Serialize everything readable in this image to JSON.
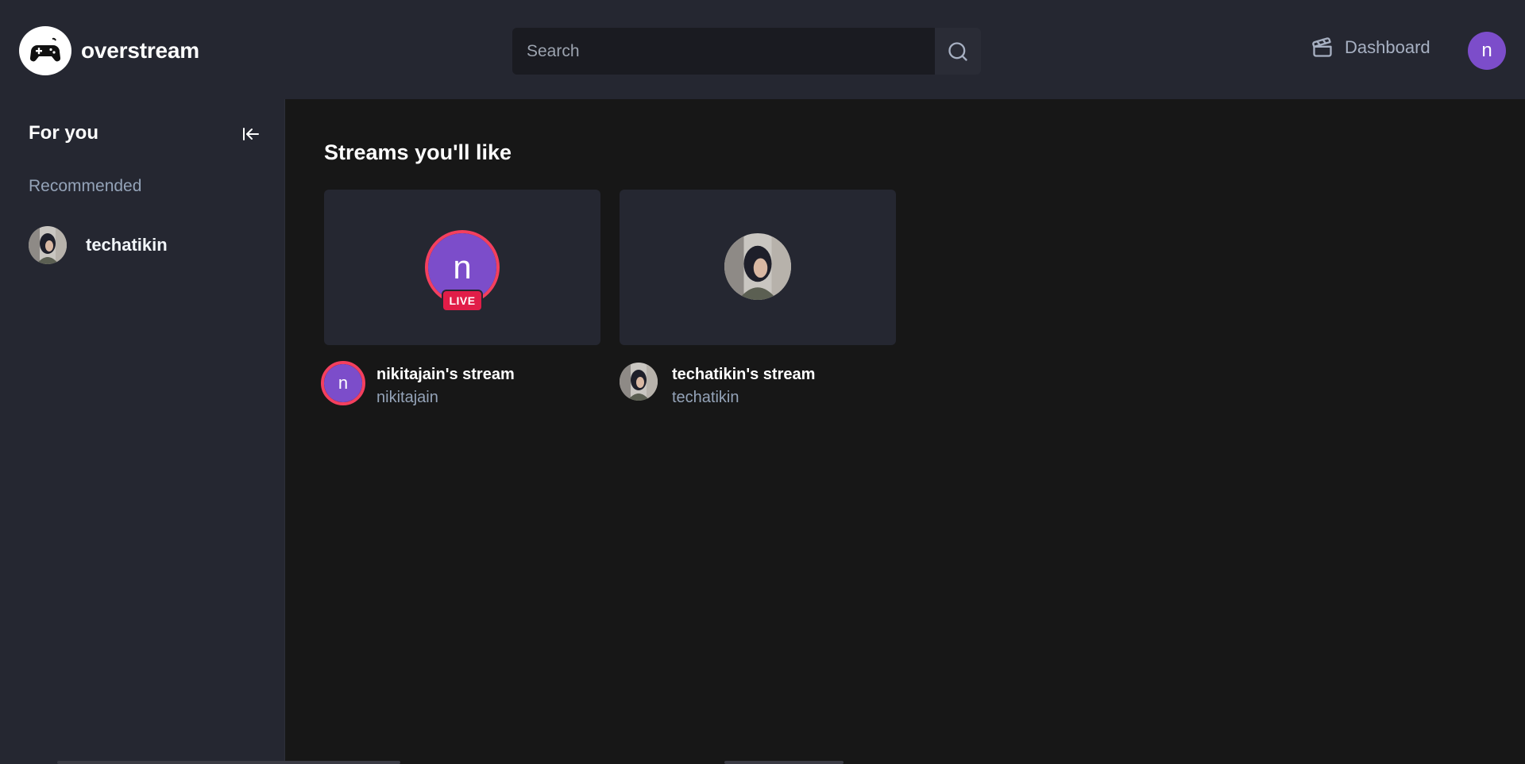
{
  "app": {
    "name": "overstream"
  },
  "search": {
    "placeholder": "Search"
  },
  "nav": {
    "dashboard_label": "Dashboard",
    "user_initial": "n"
  },
  "sidebar": {
    "title": "For you",
    "section_label": "Recommended",
    "items": [
      {
        "name": "techatikin"
      }
    ]
  },
  "main": {
    "title": "Streams you'll like",
    "streams": [
      {
        "title": "nikitajain's stream",
        "username": "nikitajain",
        "avatar_initial": "n",
        "live": true,
        "live_label": "LIVE"
      },
      {
        "title": "techatikin's stream",
        "username": "techatikin",
        "live": false
      }
    ]
  },
  "colors": {
    "accent": "#7c4dca",
    "live": "#e11d48",
    "panel": "#252731",
    "background": "#171717"
  },
  "icons": {
    "logo": "gamepad-icon",
    "search": "search-icon",
    "dashboard": "clapperboard-icon",
    "collapse": "arrow-left-to-line-icon"
  }
}
